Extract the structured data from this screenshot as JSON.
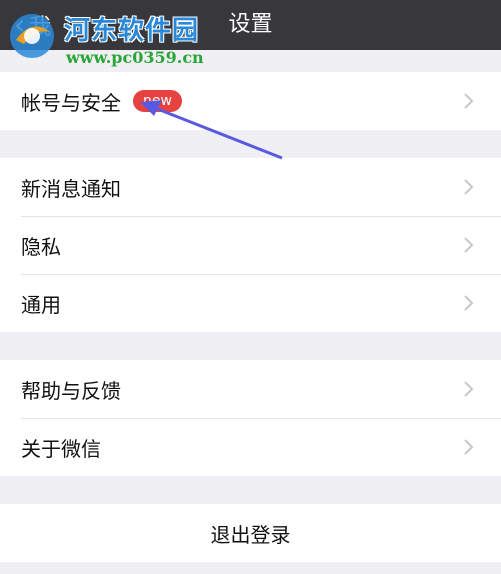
{
  "navbar": {
    "back_label": "我",
    "title": "设置"
  },
  "watermark": {
    "title": "河东软件园",
    "url": "www.pc0359.cn"
  },
  "sections": [
    {
      "items": [
        {
          "label": "帐号与安全",
          "badge": "new"
        }
      ]
    },
    {
      "items": [
        {
          "label": "新消息通知"
        },
        {
          "label": "隐私"
        },
        {
          "label": "通用"
        }
      ]
    },
    {
      "items": [
        {
          "label": "帮助与反馈"
        },
        {
          "label": "关于微信"
        }
      ]
    }
  ],
  "logout": {
    "label": "退出登录"
  },
  "colors": {
    "navbar": "#38373c",
    "background": "#efeff4",
    "badge": "#e64340",
    "annotation_arrow": "#5a5ae0"
  }
}
